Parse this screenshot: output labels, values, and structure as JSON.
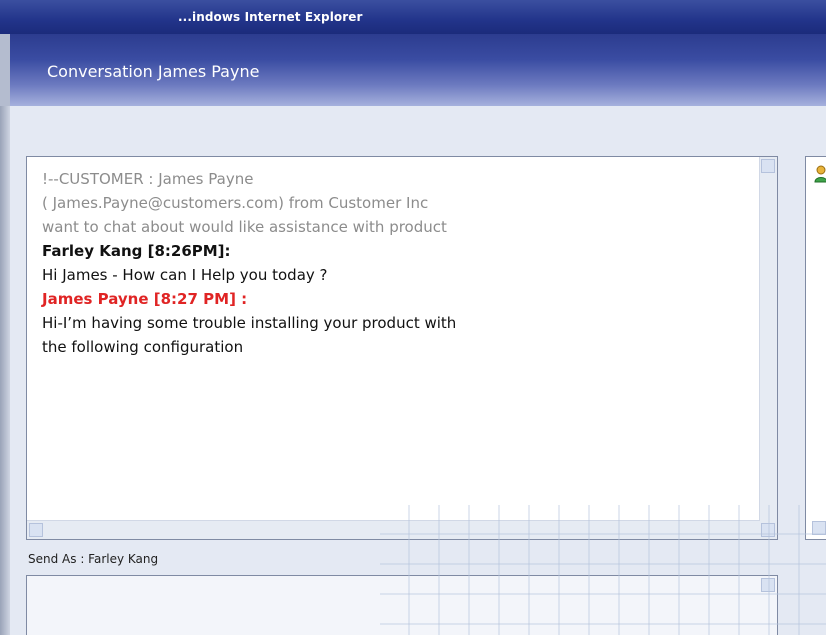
{
  "browser": {
    "title": "...indows Internet Explorer"
  },
  "conversation": {
    "title": "Conversation James Payne"
  },
  "chat": {
    "system_line1": "!--CUSTOMER : James Payne",
    "system_line2": "( James.Payne@customers.com) from Customer Inc",
    "system_line3": "want to chat about would like assistance with product",
    "msg1_sender": "Farley Kang [8:26PM]:",
    "msg1_text": "Hi James - How can I Help you today ?",
    "msg2_sender": "James Payne [8:27 PM] :",
    "msg2_text_line1": "Hi-I’m having some trouble installing your product  with",
    "msg2_text_line2": "the following configuration"
  },
  "compose": {
    "send_as": "Send As : Farley Kang"
  },
  "colors": {
    "title_bar": "#22348a",
    "agent_name": "#111111",
    "customer_name": "#e02424",
    "system_text": "#8c8c8c"
  },
  "icons": {
    "contact": "contact-icon"
  }
}
